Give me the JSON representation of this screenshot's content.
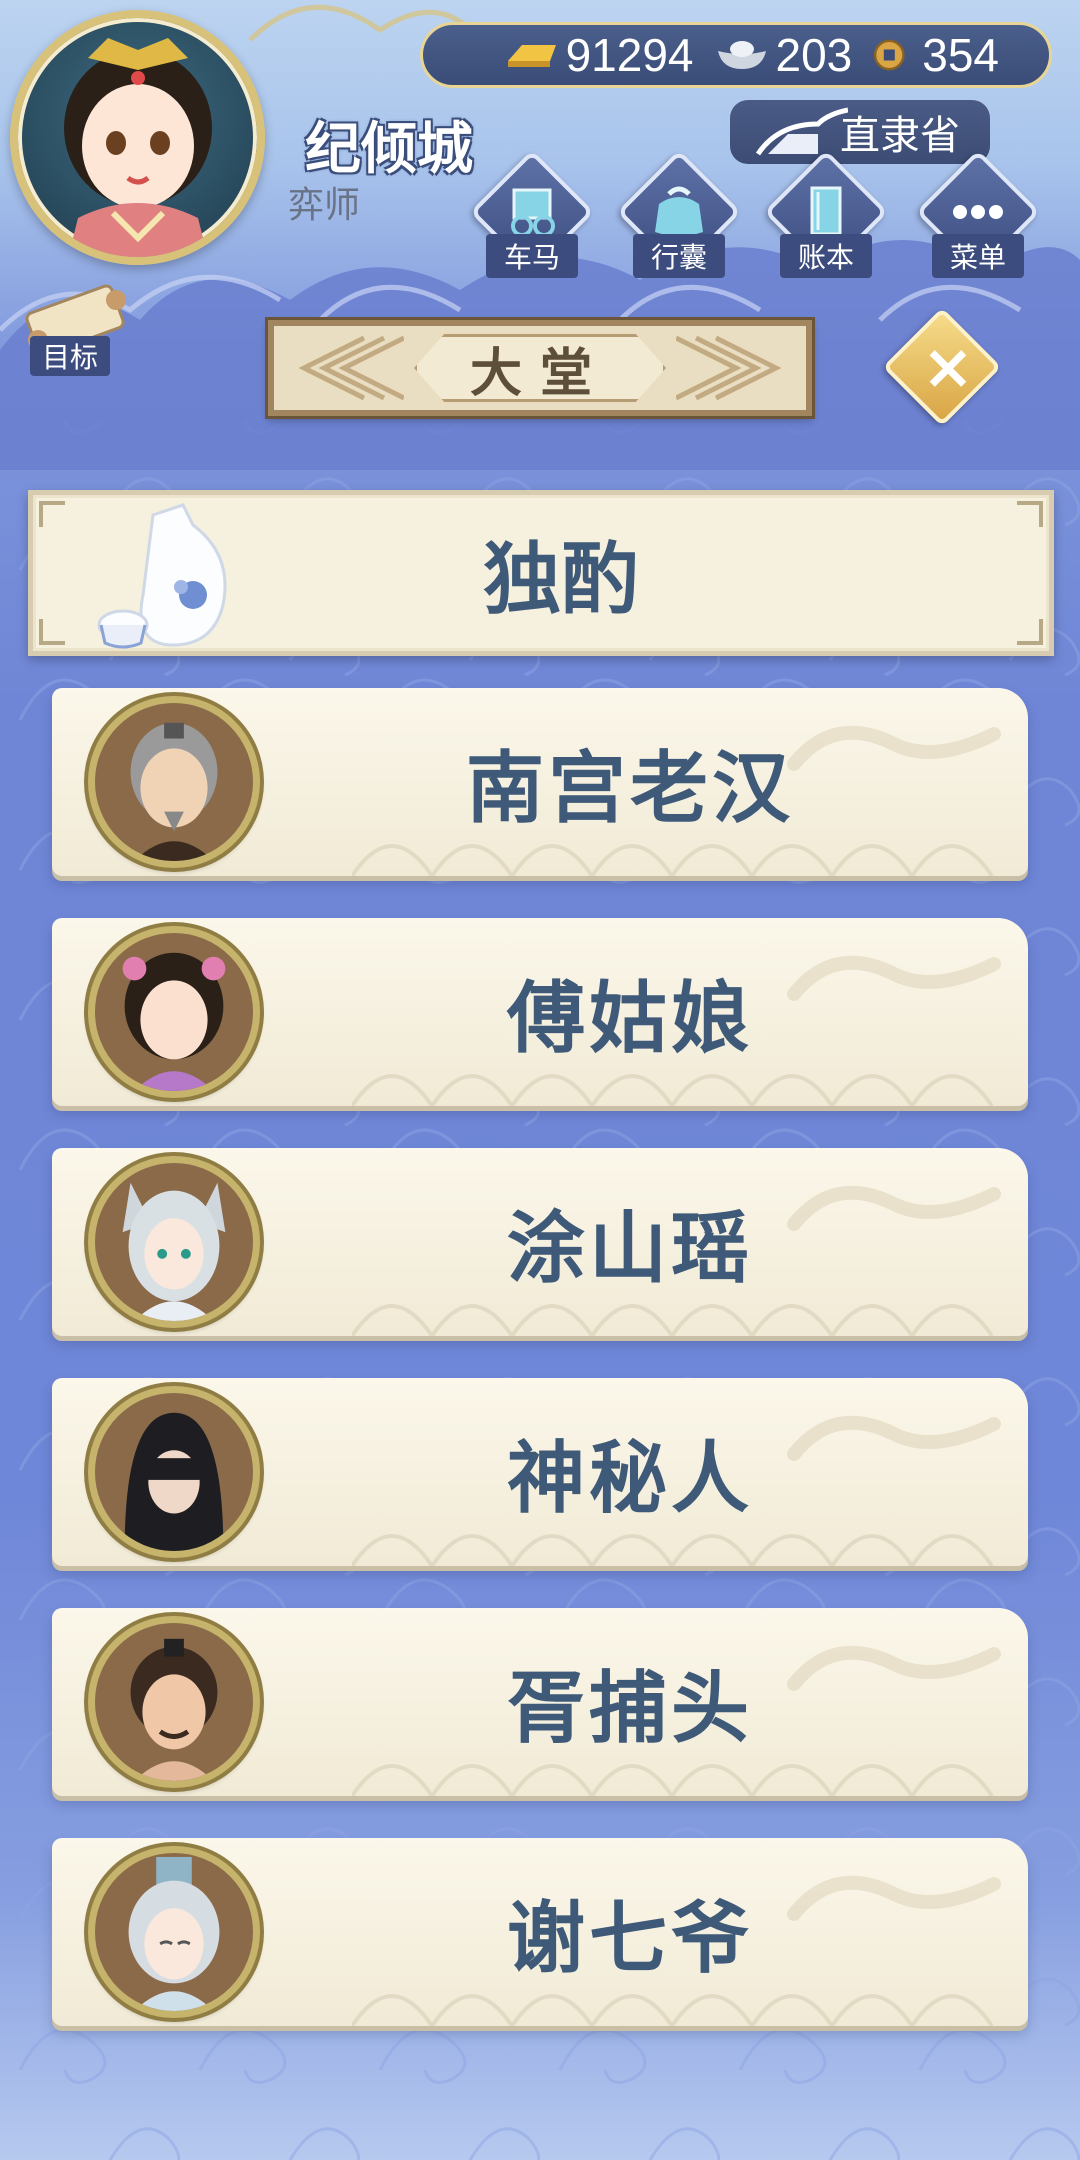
{
  "player": {
    "name": "纪倾城",
    "title": "弈师"
  },
  "currency": {
    "gold": "91294",
    "silver": "203",
    "coins": "354"
  },
  "location": "直隶省",
  "menu": [
    {
      "label": "车马",
      "icon": "carriage-icon"
    },
    {
      "label": "行囊",
      "icon": "bag-icon"
    },
    {
      "label": "账本",
      "icon": "book-icon"
    },
    {
      "label": "菜单",
      "icon": "more-icon"
    }
  ],
  "goal_label": "目标",
  "hall_title": "大堂",
  "solo_drink": "独酌",
  "npcs": [
    {
      "name": "南宫老汉",
      "avatar": "old-man-avatar"
    },
    {
      "name": "傅姑娘",
      "avatar": "young-woman-avatar"
    },
    {
      "name": "涂山瑶",
      "avatar": "fox-girl-avatar"
    },
    {
      "name": "神秘人",
      "avatar": "hooded-stranger-avatar"
    },
    {
      "name": "胥捕头",
      "avatar": "constable-avatar"
    },
    {
      "name": "谢七爷",
      "avatar": "white-haired-man-avatar"
    }
  ],
  "colors": {
    "accent_gold": "#d8c27a",
    "navy": "#3c4c7e",
    "card_text": "#3e5a78",
    "card_bg": "#f6f0de"
  }
}
